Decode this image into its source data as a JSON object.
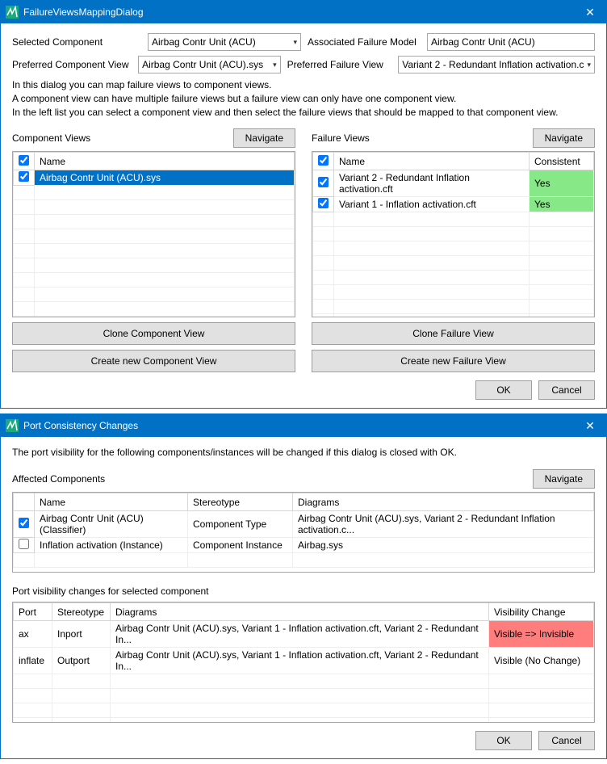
{
  "dialog1": {
    "title": "FailureViewsMappingDialog",
    "labels": {
      "selectedComponent": "Selected Component",
      "associatedFailureModel": "Associated Failure Model",
      "preferredComponentView": "Preferred Component View",
      "preferredFailureView": "Preferred Failure View",
      "componentViews": "Component Views",
      "failureViews": "Failure Views",
      "name": "Name",
      "consistent": "Consistent"
    },
    "values": {
      "selectedComponent": "Airbag Contr Unit (ACU)",
      "associatedFailureModel": "Airbag Contr Unit (ACU)",
      "preferredComponentView": "Airbag Contr Unit (ACU).sys",
      "preferredFailureView": "Variant 2 - Redundant Inflation activation.c"
    },
    "info": {
      "l1": "In this dialog you can map failure views to component views.",
      "l2": "A component view can have multiple failure views but a failure view can only have one component view.",
      "l3": "In the left list you can select a component view and then select the failure views that should be mapped to that component view."
    },
    "componentViewRows": [
      {
        "name": "Airbag Contr Unit (ACU).sys",
        "checked": true,
        "selected": true
      }
    ],
    "failureViewRows": [
      {
        "name": "Variant 2 - Redundant Inflation activation.cft",
        "consistent": "Yes",
        "checked": true
      },
      {
        "name": "Variant 1 - Inflation activation.cft",
        "consistent": "Yes",
        "checked": true
      }
    ],
    "buttons": {
      "navigate": "Navigate",
      "cloneComponent": "Clone Component View",
      "createComponent": "Create new Component View",
      "cloneFailure": "Clone Failure View",
      "createFailure": "Create new Failure View",
      "ok": "OK",
      "cancel": "Cancel"
    }
  },
  "dialog2": {
    "title": "Port Consistency Changes",
    "intro": "The port visibility for the following components/instances will be changed if this dialog is closed with OK.",
    "labels": {
      "affected": "Affected Components",
      "navigate": "Navigate",
      "name": "Name",
      "stereotype": "Stereotype",
      "diagrams": "Diagrams",
      "portChanges": "Port visibility changes for selected component",
      "port": "Port",
      "visChange": "Visibility Change"
    },
    "affectedRows": [
      {
        "checked": true,
        "name": "Airbag Contr Unit (ACU) (Classifier)",
        "stereotype": "Component Type",
        "diagrams": "Airbag Contr Unit (ACU).sys, Variant 2 - Redundant Inflation activation.c..."
      },
      {
        "checked": false,
        "name": "Inflation activation  (Instance)",
        "stereotype": "Component Instance",
        "diagrams": "Airbag.sys"
      }
    ],
    "portRows": [
      {
        "port": "ax",
        "stereotype": "Inport",
        "diagrams": "Airbag Contr Unit (ACU).sys, Variant 1 - Inflation activation.cft, Variant 2 - Redundant In...",
        "vis": "Visible => Invisible",
        "red": true
      },
      {
        "port": "inflate",
        "stereotype": "Outport",
        "diagrams": "Airbag Contr Unit (ACU).sys, Variant 1 - Inflation activation.cft, Variant 2 - Redundant In...",
        "vis": "Visible (No Change)",
        "red": false
      }
    ],
    "buttons": {
      "ok": "OK",
      "cancel": "Cancel"
    }
  }
}
